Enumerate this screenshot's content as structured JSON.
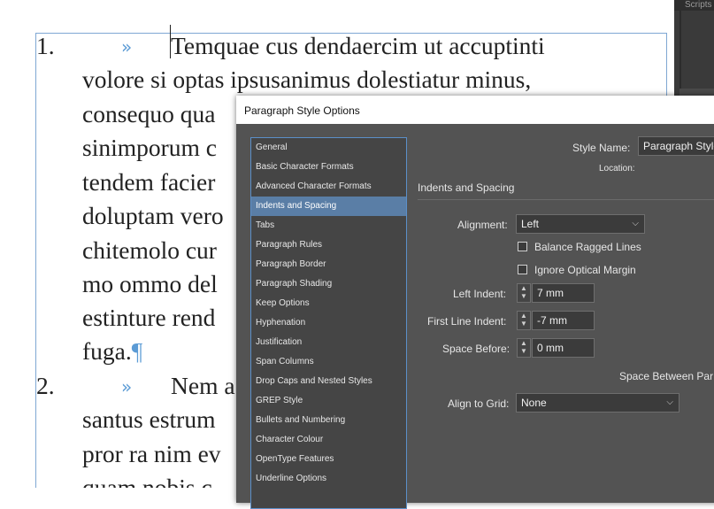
{
  "document": {
    "lines": [
      "Temquae cus dendaercim ut accuptinti",
      "volore si optas ipsusanimus dolestiatur minus,",
      "consequo qua",
      "sinimporum c",
      "tendem facier",
      "doluptam vero",
      "chitemolo cur",
      "mo ommo del",
      "estinture rend",
      "fuga.",
      "Nem a",
      "santus estrum",
      "pror ra nim ev",
      "quam nobis c"
    ],
    "list_numbers": [
      "1.",
      "2."
    ],
    "tab_glyph": "»",
    "pilcrow": "¶"
  },
  "side_panel": {
    "header": "Scripts"
  },
  "dialog": {
    "title": "Paragraph Style Options",
    "categories": [
      "General",
      "Basic Character Formats",
      "Advanced Character Formats",
      "Indents and Spacing",
      "Tabs",
      "Paragraph Rules",
      "Paragraph Border",
      "Paragraph Shading",
      "Keep Options",
      "Hyphenation",
      "Justification",
      "Span Columns",
      "Drop Caps and Nested Styles",
      "GREP Style",
      "Bullets and Numbering",
      "Character Colour",
      "OpenType Features",
      "Underline Options"
    ],
    "selected_category": "Indents and Spacing",
    "style_name_label": "Style Name:",
    "style_name_value": "Paragraph Style",
    "location_label": "Location:",
    "section_title": "Indents and Spacing",
    "alignment_label": "Alignment:",
    "alignment_value": "Left",
    "balance_ragged_lines": "Balance Ragged Lines",
    "ignore_optical_margin": "Ignore Optical Margin",
    "left_indent_label": "Left Indent:",
    "left_indent_value": "7 mm",
    "first_line_indent_label": "First Line Indent:",
    "first_line_indent_value": "-7 mm",
    "space_before_label": "Space Before:",
    "space_before_value": "0 mm",
    "space_between_label": "Space Between Par",
    "align_to_grid_label": "Align to Grid:",
    "align_to_grid_value": "None"
  }
}
